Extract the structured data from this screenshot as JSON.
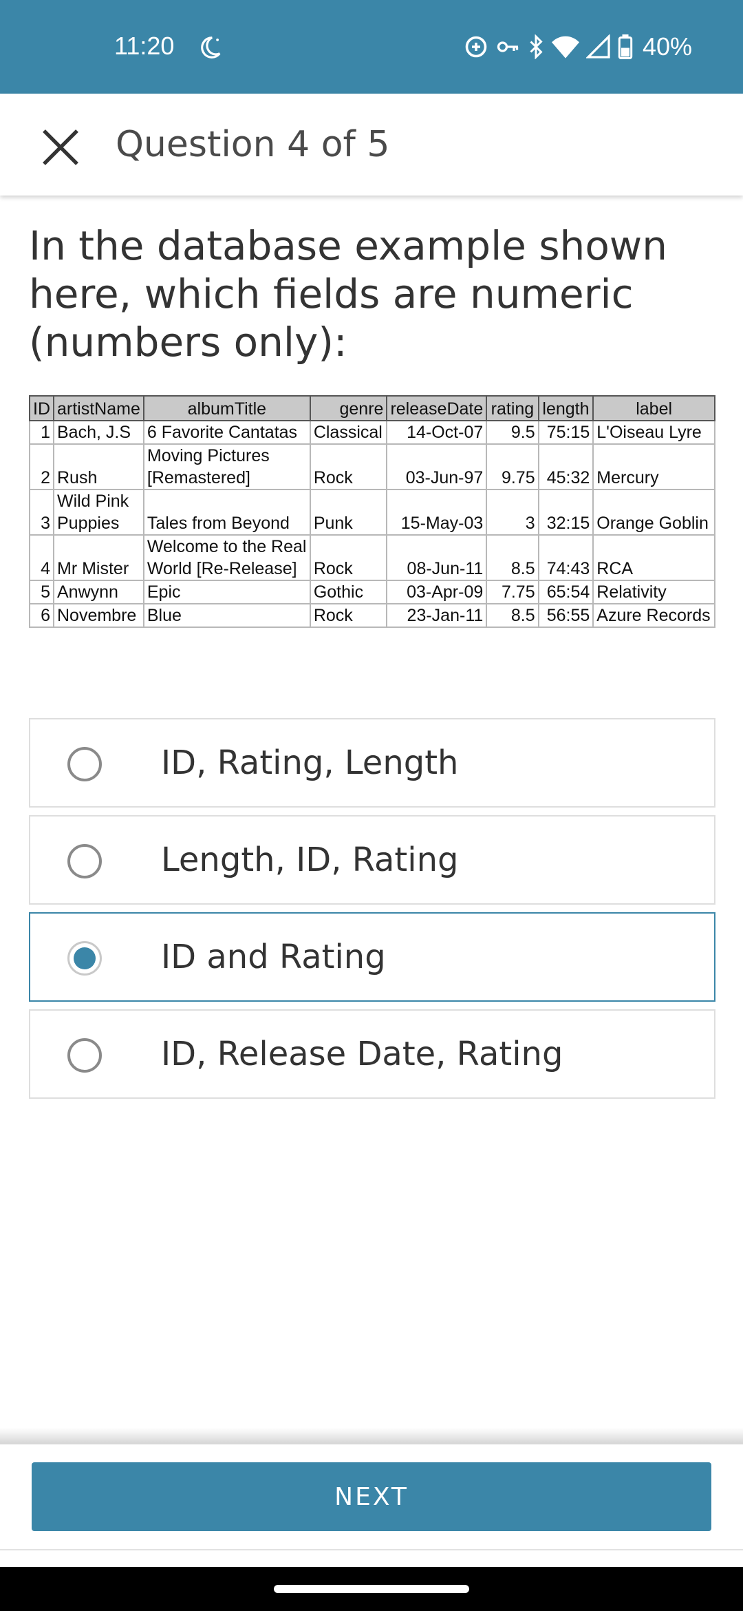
{
  "status_bar": {
    "time": "11:20",
    "battery": "40%",
    "icons": [
      "night-mode-icon",
      "data-saver-icon",
      "vpn-key-icon",
      "bluetooth-icon",
      "wifi-icon",
      "cell-signal-icon",
      "battery-icon"
    ]
  },
  "header": {
    "title": "Question 4 of 5",
    "close_icon": "close-icon"
  },
  "question": {
    "text": "In the database example shown here, which fields are numeric (numbers only):"
  },
  "table": {
    "columns": [
      "ID",
      "artistName",
      "albumTitle",
      "genre",
      "releaseDate",
      "rating",
      "length",
      "label"
    ],
    "rows": [
      [
        "1",
        "Bach, J.S",
        "6 Favorite Cantatas",
        "Classical",
        "14-Oct-07",
        "9.5",
        "75:15",
        "L'Oiseau Lyre"
      ],
      [
        "2",
        "Rush",
        "Moving Pictures [Remastered]",
        "Rock",
        "03-Jun-97",
        "9.75",
        "45:32",
        "Mercury"
      ],
      [
        "3",
        "Wild Pink Puppies",
        "Tales from Beyond",
        "Punk",
        "15-May-03",
        "3",
        "32:15",
        "Orange Goblin"
      ],
      [
        "4",
        "Mr Mister",
        "Welcome to the Real World [Re-Release]",
        "Rock",
        "08-Jun-11",
        "8.5",
        "74:43",
        "RCA"
      ],
      [
        "5",
        "Anwynn",
        "Epic",
        "Gothic",
        "03-Apr-09",
        "7.75",
        "65:54",
        "Relativity"
      ],
      [
        "6",
        "Novembre",
        "Blue",
        "Rock",
        "23-Jan-11",
        "8.5",
        "56:55",
        "Azure Records"
      ]
    ]
  },
  "options": [
    {
      "label": "ID, Rating, Length",
      "selected": false
    },
    {
      "label": "Length, ID, Rating",
      "selected": false
    },
    {
      "label": "ID and Rating",
      "selected": true
    },
    {
      "label": "ID, Release Date, Rating",
      "selected": false
    }
  ],
  "footer": {
    "next_label": "NEXT"
  },
  "colors": {
    "accent": "#3b86a8",
    "status_bar": "#3b86a8"
  }
}
